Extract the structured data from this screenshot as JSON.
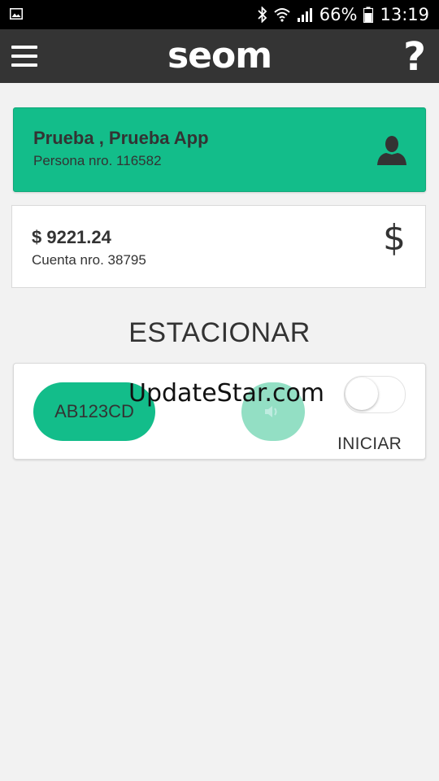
{
  "status_bar": {
    "battery_percent": "66%",
    "time": "13:19",
    "icons": [
      "image-icon",
      "bluetooth-icon",
      "wifi-icon",
      "signal-icon",
      "battery-icon"
    ]
  },
  "app_bar": {
    "menu_icon": "hamburger-menu-icon",
    "logo_text": "seom",
    "help_label": "?"
  },
  "person": {
    "name": "Prueba , Prueba App",
    "subtitle": "Persona nro. 116582",
    "icon": "user-icon"
  },
  "account": {
    "balance": "$ 9221.24",
    "subtitle": "Cuenta nro. 38795",
    "icon_glyph": "$"
  },
  "parking": {
    "title": "ESTACIONAR",
    "plate": "AB123CD",
    "sound_icon": "speaker-icon",
    "toggle_on": false,
    "toggle_label": "INICIAR"
  },
  "watermark": "UpdateStar.com",
  "colors": {
    "accent": "#13bd8a",
    "accent_light": "#93dfc4",
    "app_bar": "#343434",
    "background": "#f2f2f2"
  }
}
